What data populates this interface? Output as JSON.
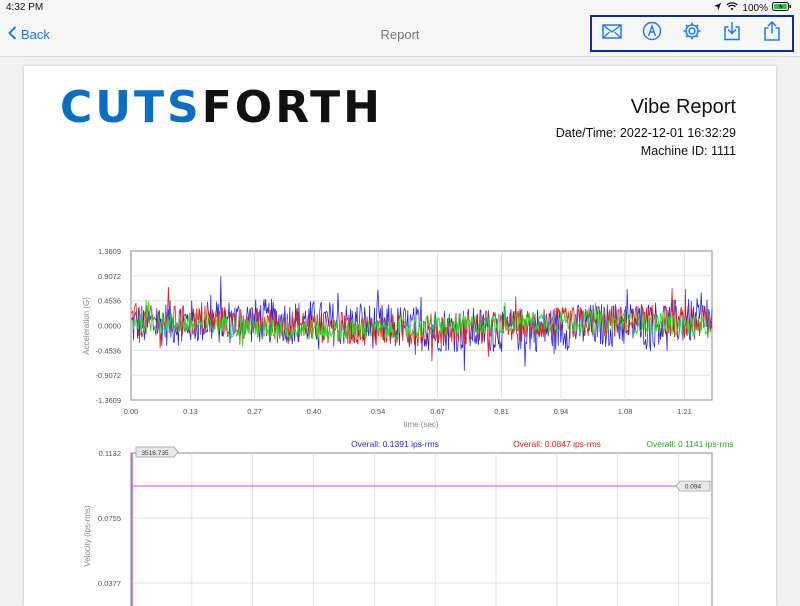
{
  "status": {
    "time": "4:32 PM",
    "battery": "100%"
  },
  "nav": {
    "back_label": "Back",
    "title": "Report"
  },
  "report": {
    "logo_part1": "CUTS",
    "logo_part2": "FORTH",
    "title": "Vibe Report",
    "datetime_label": "Date/Time:",
    "datetime_value": "2022-12-01 16:32:29",
    "machine_label": "Machine ID:",
    "machine_value": "1111"
  },
  "colors": {
    "accent": "#1d7cf2",
    "blue": "#2a2ae0",
    "red": "#e02020",
    "green": "#22dd22",
    "highlight_border": "#0b2aa3",
    "marker": "#d060d8"
  },
  "chart_data": [
    {
      "type": "line",
      "xlabel": "time (sec)",
      "ylabel": "Acceleration (G)",
      "x_ticks": [
        "0.00",
        "0.13",
        "0.27",
        "0.40",
        "0.54",
        "0.67",
        "0.81",
        "0.94",
        "1.08",
        "1.21"
      ],
      "y_ticks": [
        "1.3609",
        "0.9072",
        "0.4536",
        "0.0000",
        "-0.4536",
        "-0.9072",
        "-1.3609"
      ],
      "xlim": [
        0,
        1.27
      ],
      "ylim": [
        -1.3609,
        1.3609
      ],
      "grid": true,
      "series": [
        {
          "color": "#2a2ae0",
          "amplitude": 0.42
        },
        {
          "color": "#e02020",
          "amplitude": 0.3
        },
        {
          "color": "#22dd22",
          "amplitude": 0.2
        }
      ]
    },
    {
      "type": "line",
      "ylabel": "Velocity (ips-rms)",
      "y_ticks": [
        "0.1132",
        "0.0755",
        "0.0377"
      ],
      "ylim": [
        0,
        0.1132
      ],
      "legend": [
        {
          "text": "Overall: 0.1391 ips-rms",
          "color": "#2a2ae0"
        },
        {
          "text": "Overall: 0.0847 ips-rms",
          "color": "#e02020"
        },
        {
          "text": "Overall: 0.1141 ips-rms",
          "color": "#22aa22"
        }
      ],
      "marker_x_label": "3516.735",
      "marker_y_label": "0.094",
      "marker_y_value": 0.094
    }
  ]
}
